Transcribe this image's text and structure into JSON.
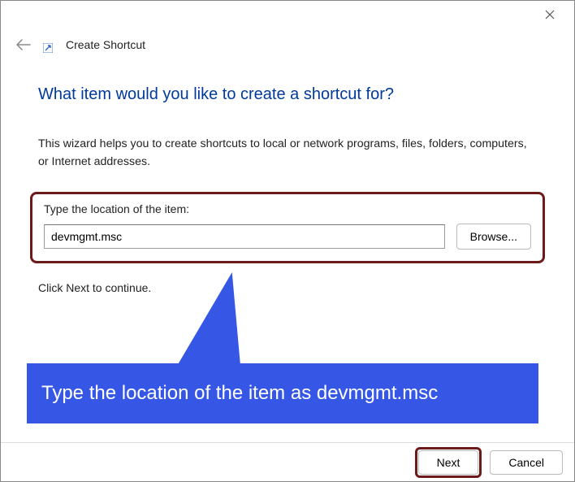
{
  "header": {
    "wizard_name": "Create Shortcut"
  },
  "main": {
    "heading": "What item would you like to create a shortcut for?",
    "description": "This wizard helps you to create shortcuts to local or network programs, files, folders, computers, or Internet addresses.",
    "location_label": "Type the location of the item:",
    "location_value": "devmgmt.msc",
    "browse_label": "Browse...",
    "continue_text": "Click Next to continue."
  },
  "annotation": {
    "text": "Type the location of the item as devmgmt.msc"
  },
  "footer": {
    "next_label": "Next",
    "cancel_label": "Cancel"
  },
  "colors": {
    "accent": "#003a9c",
    "annotation_bg": "#3657e6",
    "highlight_border": "#6d1a1a"
  }
}
